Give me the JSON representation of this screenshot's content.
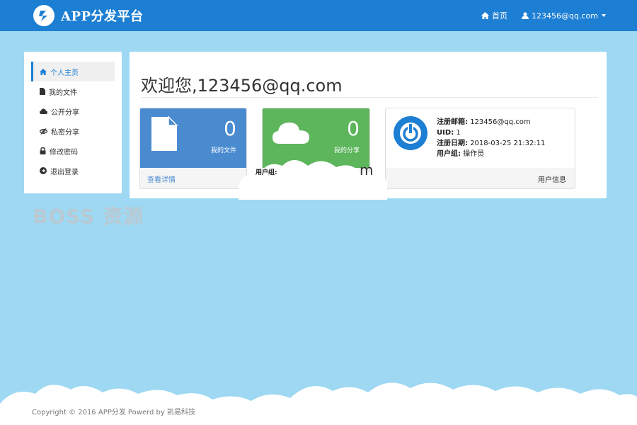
{
  "header": {
    "brand": "APP分发平台",
    "nav": {
      "home": "首页",
      "user": "123456@qq.com"
    }
  },
  "sidebar": {
    "items": [
      {
        "label": "个人主页",
        "icon": "home-icon"
      },
      {
        "label": "我的文件",
        "icon": "file-icon"
      },
      {
        "label": "公开分享",
        "icon": "cloud-icon"
      },
      {
        "label": "私密分享",
        "icon": "eye-slash-icon"
      },
      {
        "label": "修改密码",
        "icon": "lock-icon"
      },
      {
        "label": "退出登录",
        "icon": "exit-icon"
      }
    ]
  },
  "main": {
    "welcome": "欢迎您,123456@qq.com",
    "cards": {
      "files": {
        "count": "0",
        "label": "我的文件",
        "link": "查看详情"
      },
      "share": {
        "count": "0",
        "label": "我的分享"
      }
    },
    "info": {
      "email_label": "注册邮箱:",
      "email": "123456@qq.com",
      "uid_label": "UID:",
      "uid": "1",
      "date_label": "注册日期:",
      "date": "2018-03-25 21:32:11",
      "group_label": "用户组:",
      "group": "操作员",
      "footer": "用户信息"
    },
    "overlay": {
      "group_label": "用户组:",
      "fragment": "m"
    }
  },
  "watermark": "BOSS 资源",
  "footer": {
    "copyright": "Copyright © 2016 APP分发 Powerd by 凯易科技"
  },
  "colors": {
    "topbar": "#1d7fd3",
    "background": "#9ed8f2",
    "files_card": "#4a8bd0",
    "share_card": "#5db55c"
  }
}
